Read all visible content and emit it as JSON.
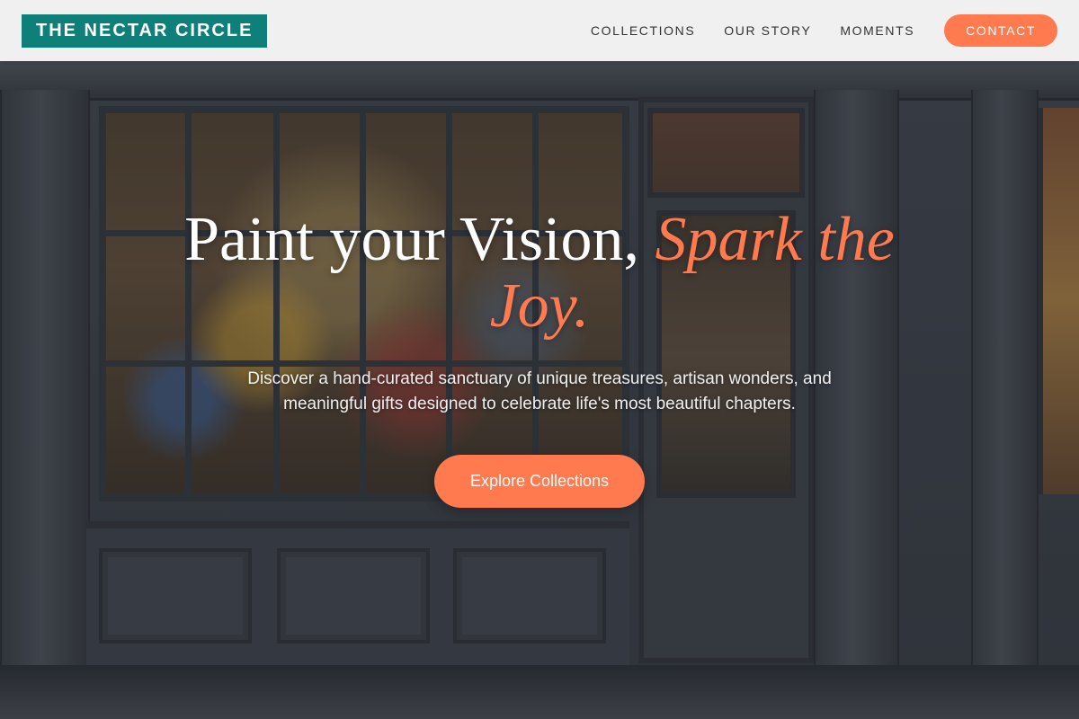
{
  "header": {
    "logo_text": "THE NECTAR CIRCLE",
    "nav": [
      {
        "label": "COLLECTIONS"
      },
      {
        "label": "OUR STORY"
      },
      {
        "label": "MOMENTS"
      }
    ],
    "cta_label": "CONTACT"
  },
  "hero": {
    "title_main": "Paint your Vision, ",
    "title_accent": "Spark the Joy.",
    "subtitle": "Discover a hand-curated sanctuary of unique treasures, artisan wonders, and meaningful gifts designed to celebrate life's most beautiful chapters.",
    "button_label": "Explore Collections",
    "background": "storefront-photo"
  },
  "colors": {
    "brand_teal": "#0f7f7a",
    "accent_coral": "#ff7a4f",
    "header_bg": "#f8f8f8",
    "nav_text": "#333333"
  }
}
